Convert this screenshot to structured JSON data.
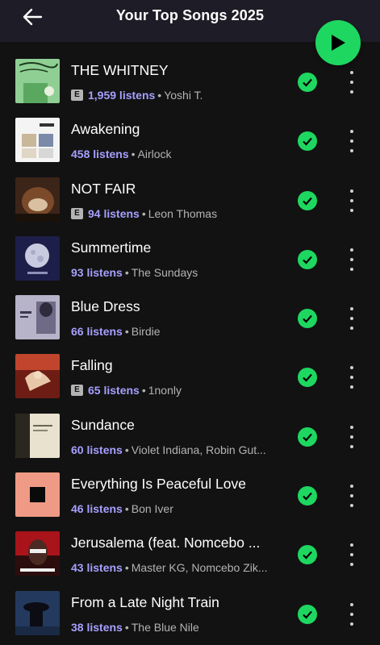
{
  "header": {
    "title": "Your Top Songs 2025",
    "back_icon": "arrow-left-icon",
    "play_icon": "play-icon"
  },
  "colors": {
    "accent": "#1ed760",
    "listens": "#a6a0ff",
    "background": "#121212",
    "header_bg": "#1e1d27"
  },
  "songs": [
    {
      "title": "THE WHITNEY",
      "explicit": true,
      "explicit_label": "E",
      "listens": "1,959 listens",
      "artist": "Yoshi T."
    },
    {
      "title": "Awakening",
      "explicit": false,
      "explicit_label": "",
      "listens": "458 listens",
      "artist": "Airlock"
    },
    {
      "title": "NOT FAIR",
      "explicit": true,
      "explicit_label": "E",
      "listens": "94 listens",
      "artist": "Leon Thomas"
    },
    {
      "title": "Summertime",
      "explicit": false,
      "explicit_label": "",
      "listens": "93 listens",
      "artist": "The Sundays"
    },
    {
      "title": "Blue Dress",
      "explicit": false,
      "explicit_label": "",
      "listens": "66 listens",
      "artist": "Birdie"
    },
    {
      "title": "Falling",
      "explicit": true,
      "explicit_label": "E",
      "listens": "65 listens",
      "artist": "1nonly"
    },
    {
      "title": "Sundance",
      "explicit": false,
      "explicit_label": "",
      "listens": "60 listens",
      "artist": "Violet Indiana, Robin Gut..."
    },
    {
      "title": "Everything Is Peaceful Love",
      "explicit": false,
      "explicit_label": "",
      "listens": "46 listens",
      "artist": "Bon Iver"
    },
    {
      "title": "Jerusalema (feat. Nomcebo ...",
      "explicit": false,
      "explicit_label": "",
      "listens": "43 listens",
      "artist": "Master KG, Nomcebo Zik..."
    },
    {
      "title": "From a Late Night Train",
      "explicit": false,
      "explicit_label": "",
      "listens": "38 listens",
      "artist": "The Blue Nile"
    }
  ],
  "separator": "•"
}
